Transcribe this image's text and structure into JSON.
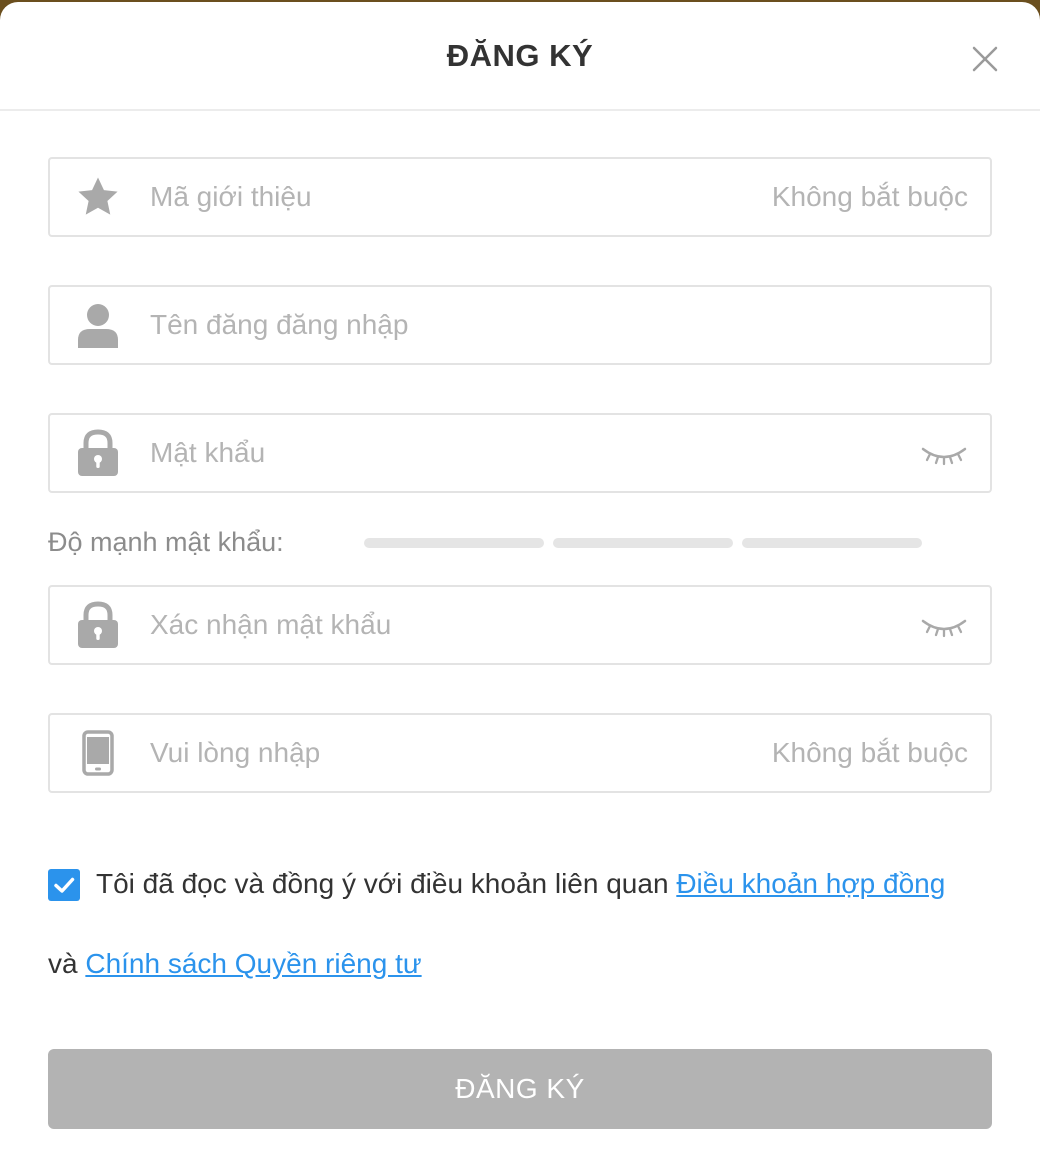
{
  "header": {
    "title": "ĐĂNG KÝ"
  },
  "fields": {
    "referral": {
      "icon": "star-icon",
      "placeholder": "Mã giới thiệu",
      "hint": "Không bắt buộc"
    },
    "username": {
      "icon": "user-icon",
      "placeholder": "Tên đăng đăng nhập"
    },
    "password": {
      "icon": "lock-icon",
      "placeholder": "Mật khẩu",
      "toggle_icon": "eye-closed-icon"
    },
    "password_strength": {
      "label": "Độ mạnh mật khẩu:",
      "level": 0,
      "segments": 3
    },
    "confirm_password": {
      "icon": "lock-icon",
      "placeholder": "Xác nhận mật khẩu",
      "toggle_icon": "eye-closed-icon"
    },
    "phone": {
      "icon": "phone-icon",
      "placeholder": "Vui lòng nhập",
      "hint": "Không bắt buộc"
    }
  },
  "agreement": {
    "checked": true,
    "text": "Tôi đã đọc và đồng ý với điều khoản liên quan ",
    "terms_link": "Điều khoản hợp đồng",
    "and_text": "và ",
    "privacy_link": "Chính sách Quyền riêng tư"
  },
  "submit": {
    "label": "ĐĂNG KÝ"
  },
  "colors": {
    "accent": "#2b93ec",
    "button_disabled": "#b3b3b3",
    "icon_gray": "#a9a9a9",
    "placeholder": "#b4b4b4"
  }
}
